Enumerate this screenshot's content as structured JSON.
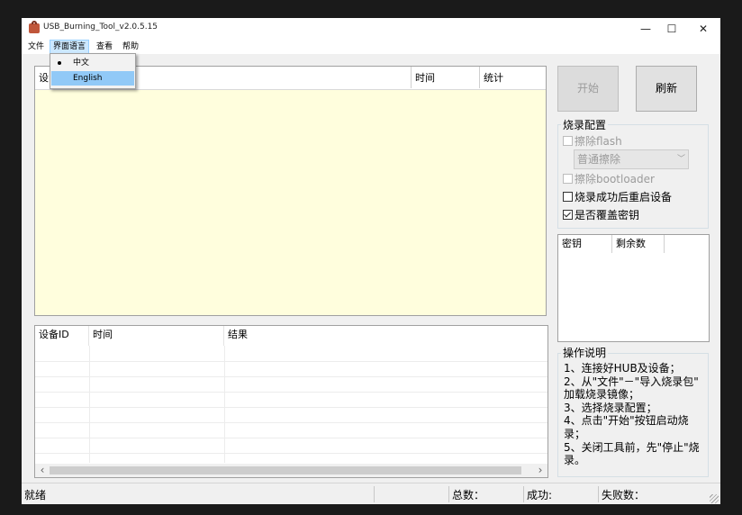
{
  "window": {
    "title": "USB_Burning_Tool_v2.0.5.15",
    "minimize": "—",
    "maximize": "☐",
    "close": "✕"
  },
  "menu": {
    "items": [
      {
        "label": "文件"
      },
      {
        "label": "界面语言"
      },
      {
        "label": "查看"
      },
      {
        "label": "帮助"
      }
    ]
  },
  "language_menu": {
    "options": [
      {
        "label": "中文",
        "selected": true
      },
      {
        "label": "English",
        "highlighted": true
      }
    ]
  },
  "device_table": {
    "columns": [
      "设",
      "时间",
      "统计"
    ]
  },
  "buttons": {
    "start": "开始",
    "refresh": "刷新"
  },
  "burn_config": {
    "title": "烧录配置",
    "erase_flash": "擦除flash",
    "erase_mode": "普通擦除",
    "erase_bootloader": "擦除bootloader",
    "reboot_after_success": "烧录成功后重启设备",
    "overwrite_key": "是否覆盖密钥"
  },
  "key_table": {
    "columns": [
      "密钥",
      "剩余数"
    ]
  },
  "log_table": {
    "columns": [
      "设备ID",
      "时间",
      "结果"
    ]
  },
  "instructions": {
    "title": "操作说明",
    "lines": [
      "1、连接好HUB及设备；",
      "2、从\"文件\"－\"导入烧录包\"",
      "加载烧录镜像；",
      "3、选择烧录配置；",
      "4、点击\"开始\"按钮启动烧",
      "录；",
      "5、关闭工具前，先\"停止\"烧",
      "录。"
    ]
  },
  "status": {
    "state": "就绪",
    "total": "总数：",
    "success": "成功:",
    "failed": "失败数："
  },
  "scroll": {
    "left": "‹",
    "right": "›"
  },
  "colors": {
    "panel_bg": "#fffedd",
    "menu_highlight": "#cce8ff",
    "dropdown_highlight": "#91c9f7"
  }
}
